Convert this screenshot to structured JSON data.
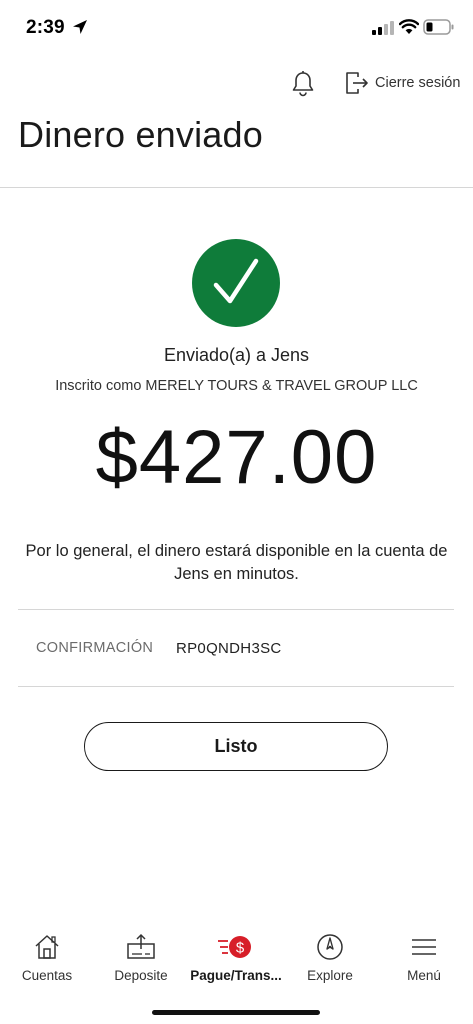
{
  "status_bar": {
    "time": "2:39"
  },
  "header": {
    "logout_label": "Cierre sesión",
    "title": "Dinero enviado"
  },
  "confirmation": {
    "sent_to": "Enviado(a) a Jens",
    "enrolled_as": "Inscrito como MERELY TOURS & TRAVEL GROUP LLC",
    "amount": "$427.00",
    "availability": "Por lo general, el dinero estará disponible en la cuenta de Jens en minutos.",
    "code_label": "CONFIRMACIÓN",
    "code_value": "RP0QNDH3SC",
    "done_label": "Listo"
  },
  "tabs": [
    {
      "label": "Cuentas",
      "icon": "home-icon"
    },
    {
      "label": "Deposite",
      "icon": "deposit-icon"
    },
    {
      "label": "Pague/Trans...",
      "icon": "pay-transfer-icon"
    },
    {
      "label": "Explore",
      "icon": "compass-icon"
    },
    {
      "label": "Menú",
      "icon": "menu-icon"
    }
  ],
  "colors": {
    "success_green": "#0f7c3a",
    "brand_red": "#d71e28"
  }
}
